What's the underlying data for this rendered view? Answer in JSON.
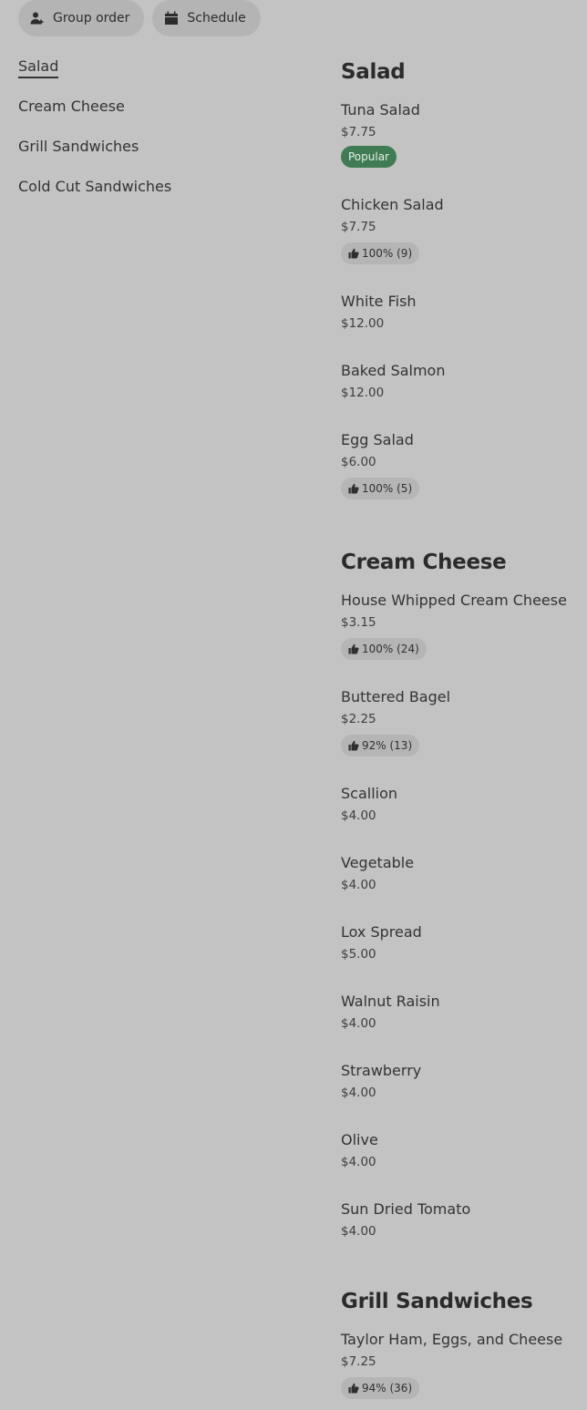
{
  "top_buttons": {
    "group_order": {
      "label": "Group order",
      "icon": "person-add-icon"
    },
    "schedule": {
      "label": "Schedule",
      "icon": "calendar-icon"
    }
  },
  "sidebar": {
    "items": [
      {
        "label": "Salad",
        "active": true
      },
      {
        "label": "Cream Cheese",
        "active": false
      },
      {
        "label": "Grill Sandwiches",
        "active": false
      },
      {
        "label": "Cold Cut Sandwiches",
        "active": false
      }
    ]
  },
  "menu": {
    "sections": [
      {
        "title": "Salad",
        "items": [
          {
            "name": "Tuna Salad",
            "price": "$7.75",
            "badge": "Popular"
          },
          {
            "name": "Chicken Salad",
            "price": "$7.75",
            "rating": "100% (9)"
          },
          {
            "name": "White Fish",
            "price": "$12.00"
          },
          {
            "name": "Baked Salmon",
            "price": "$12.00"
          },
          {
            "name": "Egg Salad",
            "price": "$6.00",
            "rating": "100% (5)"
          }
        ]
      },
      {
        "title": "Cream Cheese",
        "items": [
          {
            "name": "House Whipped Cream Cheese",
            "price": "$3.15",
            "rating": "100% (24)"
          },
          {
            "name": "Buttered Bagel",
            "price": "$2.25",
            "rating": "92% (13)"
          },
          {
            "name": "Scallion",
            "price": "$4.00"
          },
          {
            "name": "Vegetable",
            "price": "$4.00"
          },
          {
            "name": "Lox Spread",
            "price": "$5.00"
          },
          {
            "name": "Walnut Raisin",
            "price": "$4.00"
          },
          {
            "name": "Strawberry",
            "price": "$4.00"
          },
          {
            "name": "Olive",
            "price": "$4.00"
          },
          {
            "name": "Sun Dried Tomato",
            "price": "$4.00"
          }
        ]
      },
      {
        "title": "Grill Sandwiches",
        "items": [
          {
            "name": "Taylor Ham, Eggs, and Cheese",
            "price": "$7.25",
            "rating": "94% (36)"
          }
        ]
      }
    ]
  },
  "colors": {
    "background": "#c3c3c3",
    "popular_badge": "#3f7b53",
    "rating_badge": "#b5b5b5"
  }
}
